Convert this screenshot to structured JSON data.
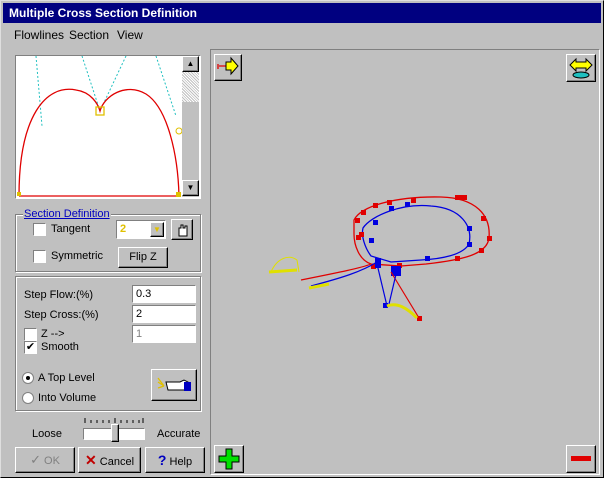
{
  "window": {
    "title": "Multiple Cross Section Definition"
  },
  "menu": [
    "Flowlines",
    "Section",
    "View"
  ],
  "section_definition": {
    "title": "Section Definition",
    "tangent_label": "Tangent",
    "tangent_checked": false,
    "tangent_value": "2",
    "symmetric_label": "Symmetric",
    "symmetric_checked": false,
    "flipz_label": "Flip Z"
  },
  "params": {
    "step_flow_label": "Step Flow:(%)",
    "step_flow_value": "0.3",
    "step_cross_label": "Step Cross:(%)",
    "step_cross_value": "2",
    "z_label": "Z -->",
    "z_checked": false,
    "z_value": "1",
    "smooth_label": "Smooth",
    "smooth_checked": true,
    "radio_top": "A Top Level",
    "radio_volume": "Into Volume",
    "selected": "top"
  },
  "slider": {
    "left_label": "Loose",
    "right_label": "Accurate"
  },
  "buttons": {
    "ok": "OK",
    "cancel": "Cancel",
    "help": "Help"
  }
}
